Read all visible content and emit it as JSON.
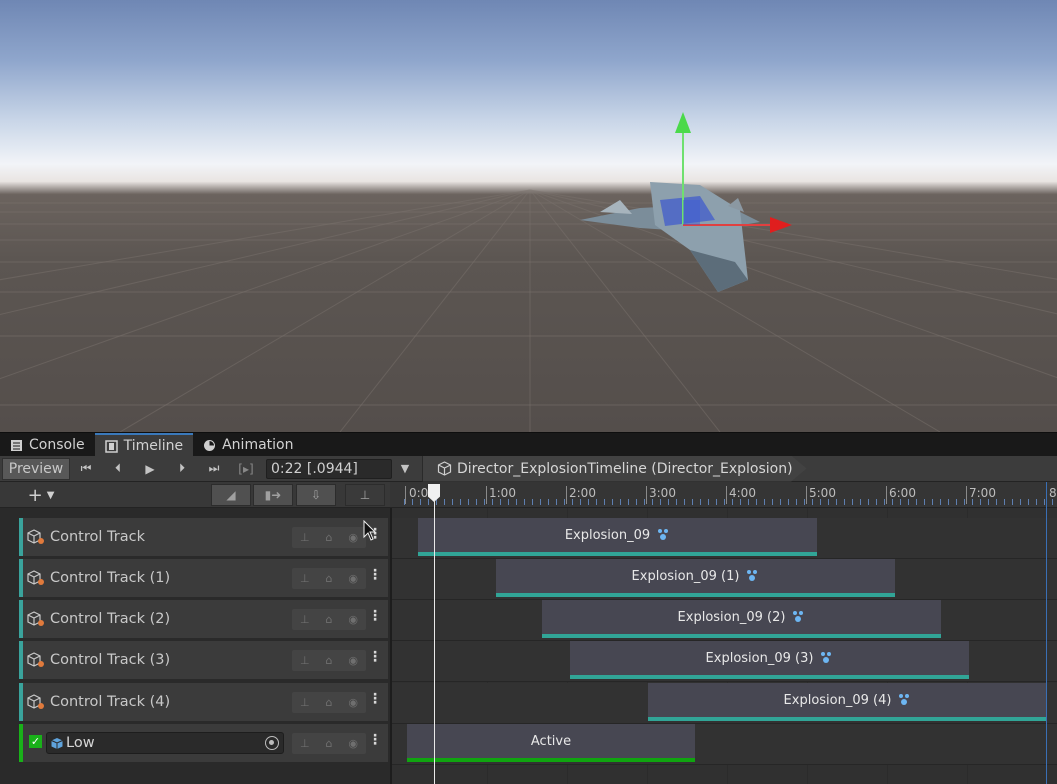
{
  "tabs": [
    {
      "label": "Console",
      "icon": "console-icon",
      "active": false
    },
    {
      "label": "Timeline",
      "icon": "film-icon",
      "active": true
    },
    {
      "label": "Animation",
      "icon": "clock-icon",
      "active": false
    }
  ],
  "toolbar": {
    "preview_label": "Preview",
    "time_value": "0:22 [.0944]",
    "breadcrumb": "Director_ExplosionTimeline (Director_Explosion)",
    "nav_icons": [
      "go-to-start-icon",
      "previous-frame-icon",
      "play-icon",
      "next-frame-icon",
      "go-to-end-icon",
      "play-range-icon"
    ]
  },
  "ruler": {
    "labels": [
      "0:0",
      "1:00",
      "2:00",
      "3:00",
      "4:00",
      "5:00",
      "6:00",
      "7:00",
      "8"
    ]
  },
  "tracks": [
    {
      "name": "Control Track",
      "clip": "Explosion_09"
    },
    {
      "name": "Control Track (1)",
      "clip": "Explosion_09 (1)"
    },
    {
      "name": "Control Track (2)",
      "clip": "Explosion_09 (2)"
    },
    {
      "name": "Control Track (3)",
      "clip": "Explosion_09 (3)"
    },
    {
      "name": "Control Track (4)",
      "clip": "Explosion_09 (4)"
    }
  ],
  "activation_track": {
    "object_name": "Low",
    "clip": "Active",
    "enabled": true
  },
  "colors": {
    "accent": "#3a79bb",
    "control_track": "#3aa39c",
    "activation_track": "#19b119"
  }
}
